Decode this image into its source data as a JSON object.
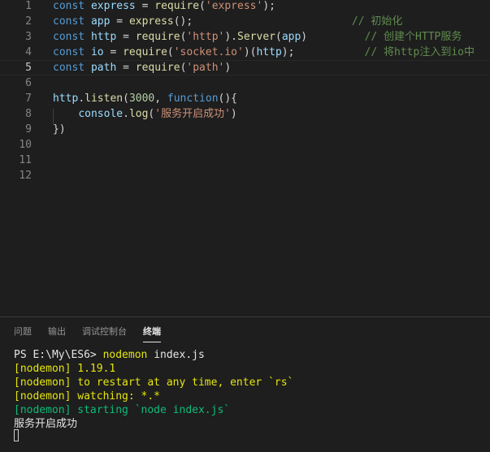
{
  "editor": {
    "lines": [
      {
        "n": "1",
        "parts": [
          [
            "kw",
            "const "
          ],
          [
            "var",
            "express"
          ],
          [
            "punct",
            " = "
          ],
          [
            "fn",
            "require"
          ],
          [
            "punct",
            "("
          ],
          [
            "str",
            "'express'"
          ],
          [
            "punct",
            ");"
          ]
        ]
      },
      {
        "n": "2",
        "parts": [
          [
            "kw",
            "const "
          ],
          [
            "var",
            "app"
          ],
          [
            "punct",
            " = "
          ],
          [
            "fn",
            "express"
          ],
          [
            "punct",
            "();"
          ],
          [
            "punct",
            "                         "
          ],
          [
            "cmt",
            "// 初始化"
          ]
        ]
      },
      {
        "n": "3",
        "parts": [
          [
            "kw",
            "const "
          ],
          [
            "var",
            "http"
          ],
          [
            "punct",
            " = "
          ],
          [
            "fn",
            "require"
          ],
          [
            "punct",
            "("
          ],
          [
            "str",
            "'http'"
          ],
          [
            "punct",
            ")."
          ],
          [
            "fn",
            "Server"
          ],
          [
            "punct",
            "("
          ],
          [
            "var",
            "app"
          ],
          [
            "punct",
            ")"
          ],
          [
            "punct",
            "         "
          ],
          [
            "cmt",
            "// 创建个HTTP服务"
          ]
        ]
      },
      {
        "n": "4",
        "parts": [
          [
            "kw",
            "const "
          ],
          [
            "var",
            "io"
          ],
          [
            "punct",
            " = "
          ],
          [
            "fn",
            "require"
          ],
          [
            "punct",
            "("
          ],
          [
            "str",
            "'socket.io'"
          ],
          [
            "punct",
            ")("
          ],
          [
            "var",
            "http"
          ],
          [
            "punct",
            ");"
          ],
          [
            "punct",
            "           "
          ],
          [
            "cmt",
            "// 将http注入到io中"
          ]
        ]
      },
      {
        "n": "5",
        "parts": [
          [
            "kw",
            "const "
          ],
          [
            "var",
            "path"
          ],
          [
            "punct",
            " = "
          ],
          [
            "fn",
            "require"
          ],
          [
            "punct",
            "("
          ],
          [
            "str",
            "'path'"
          ],
          [
            "punct",
            ")"
          ]
        ]
      },
      {
        "n": "6",
        "parts": []
      },
      {
        "n": "7",
        "parts": [
          [
            "var",
            "http"
          ],
          [
            "punct",
            "."
          ],
          [
            "fn",
            "listen"
          ],
          [
            "punct",
            "("
          ],
          [
            "num",
            "3000"
          ],
          [
            "punct",
            ", "
          ],
          [
            "kw",
            "function"
          ],
          [
            "punct",
            "(){"
          ]
        ]
      },
      {
        "n": "8",
        "parts": [
          [
            "punct",
            "    "
          ],
          [
            "var",
            "console"
          ],
          [
            "punct",
            "."
          ],
          [
            "fn",
            "log"
          ],
          [
            "punct",
            "("
          ],
          [
            "str",
            "'服务开启成功'"
          ],
          [
            "punct",
            ")"
          ]
        ]
      },
      {
        "n": "9",
        "parts": [
          [
            "punct",
            "})"
          ]
        ]
      },
      {
        "n": "10",
        "parts": []
      },
      {
        "n": "11",
        "parts": []
      },
      {
        "n": "12",
        "parts": []
      }
    ],
    "active_line": "5"
  },
  "panel": {
    "tabs": [
      {
        "label": "问题",
        "active": false
      },
      {
        "label": "输出",
        "active": false
      },
      {
        "label": "调试控制台",
        "active": false
      },
      {
        "label": "终端",
        "active": true
      }
    ],
    "terminal": [
      {
        "parts": [
          [
            "t-white",
            "PS E:\\My\\ES6> "
          ],
          [
            "t-yellow",
            "nodemon"
          ],
          [
            "t-white",
            " index.js"
          ]
        ]
      },
      {
        "parts": [
          [
            "t-yellow",
            "[nodemon] 1.19.1"
          ]
        ]
      },
      {
        "parts": [
          [
            "t-yellow",
            "[nodemon] to restart at any time, enter `rs`"
          ]
        ]
      },
      {
        "parts": [
          [
            "t-yellow",
            "[nodemon] watching: *.*"
          ]
        ]
      },
      {
        "parts": [
          [
            "t-green",
            "[nodemon] starting `node index.js`"
          ]
        ]
      },
      {
        "parts": [
          [
            "t-white",
            "服务开启成功"
          ]
        ]
      }
    ]
  },
  "colors": {
    "background": "#1e1e1e",
    "keyword": "#569cd6",
    "variable": "#9cdcfe",
    "function": "#dcdcaa",
    "string": "#ce9178",
    "number": "#b5cea8",
    "comment": "#608b4e",
    "terminal_yellow": "#e5e510",
    "terminal_green": "#0dbc79"
  }
}
